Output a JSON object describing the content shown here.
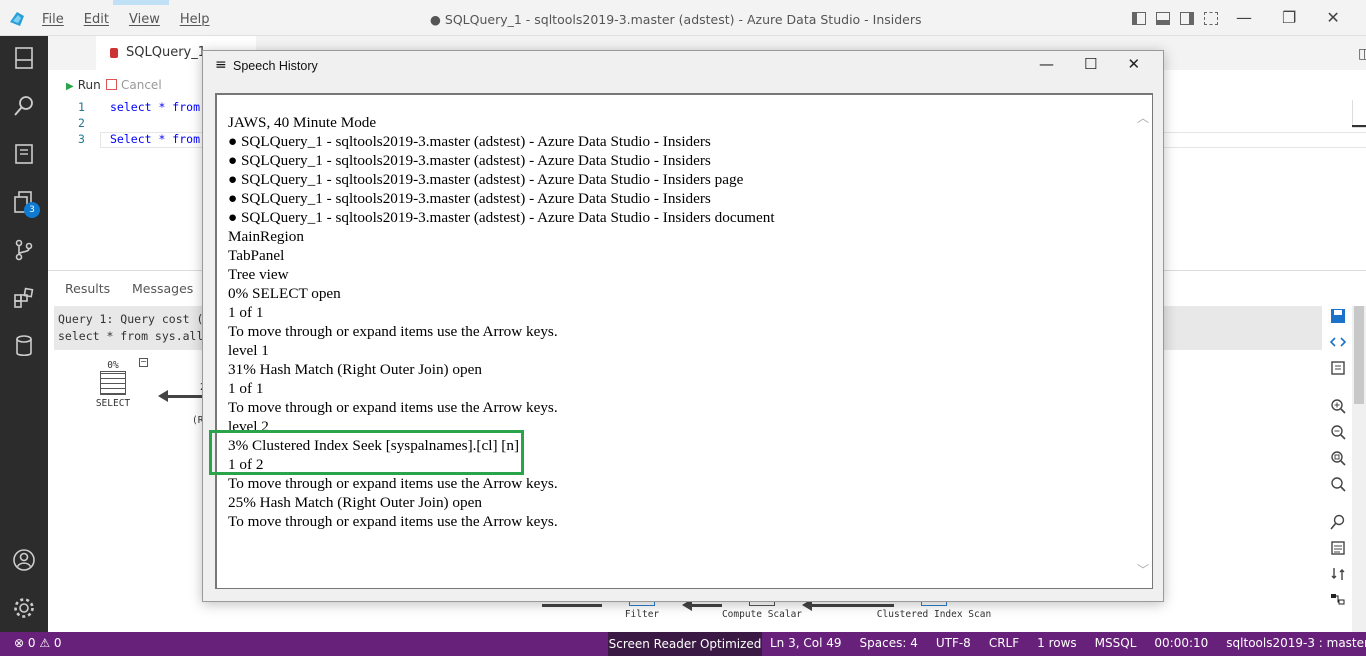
{
  "app": {
    "window_title": "● SQLQuery_1 - sqltools2019-3.master (adstest) - Azure Data Studio - Insiders",
    "menu": [
      "File",
      "Edit",
      "View",
      "Help"
    ]
  },
  "editor": {
    "active_tab": "SQLQuery_1 - sqltoo...",
    "toolbar": {
      "run": "Run",
      "cancel": "Cancel"
    },
    "lines": [
      {
        "num": "1",
        "text": "select * from"
      },
      {
        "num": "2",
        "text": ""
      },
      {
        "num": "3",
        "text": "Select * from"
      }
    ]
  },
  "activity": {
    "extensions_badge": "3"
  },
  "panel": {
    "tabs": [
      "Results",
      "Messages"
    ],
    "query_line1": "Query 1: Query cost (r",
    "query_line2": "select * from sys.all_",
    "plan_nodes": {
      "select_pct": "0%",
      "select_label": "SELECT",
      "arrow_label_top": "2",
      "arrow_label_bottom": "(R",
      "filter": "Filter",
      "compute_scalar": "Compute Scalar",
      "clustered_index_scan": "Clustered Index Scan"
    }
  },
  "speech_history": {
    "title": "Speech History",
    "lines": [
      "JAWS, 40 Minute Mode",
      "● SQLQuery_1 - sqltools2019-3.master (adstest) - Azure Data Studio - Insiders",
      "● SQLQuery_1 - sqltools2019-3.master (adstest) - Azure Data Studio - Insiders",
      "● SQLQuery_1 - sqltools2019-3.master (adstest) - Azure Data Studio - Insiders page",
      "● SQLQuery_1 - sqltools2019-3.master (adstest) - Azure Data Studio - Insiders",
      "● SQLQuery_1 - sqltools2019-3.master (adstest) - Azure Data Studio - Insiders document",
      "MainRegion",
      "TabPanel",
      "Tree view",
      "0% SELECT open",
      "1 of 1",
      "To move through or expand items use the Arrow keys.",
      "level 1",
      "31% Hash Match (Right Outer Join) open",
      "1 of 1",
      "To move through or expand items use the Arrow keys.",
      "level 2",
      "3% Clustered Index Seek [syspalnames].[cl] [n]",
      "1 of 2",
      "To move through or expand items use the Arrow keys.",
      "25% Hash Match (Right Outer Join) open",
      "To move through or expand items use the Arrow keys."
    ]
  },
  "statusbar": {
    "problems": "⊗ 0 ⚠ 0",
    "screen_reader": "Screen Reader Optimized",
    "items": [
      "Ln 3, Col 49",
      "Spaces: 4",
      "UTF-8",
      "CRLF",
      "1 rows",
      "MSSQL",
      "00:00:10",
      "sqltools2019-3 : master"
    ]
  },
  "colors": {
    "statusbar": "#68217a",
    "highlight": "#2aa44a",
    "activity": "#2c2c2c"
  }
}
